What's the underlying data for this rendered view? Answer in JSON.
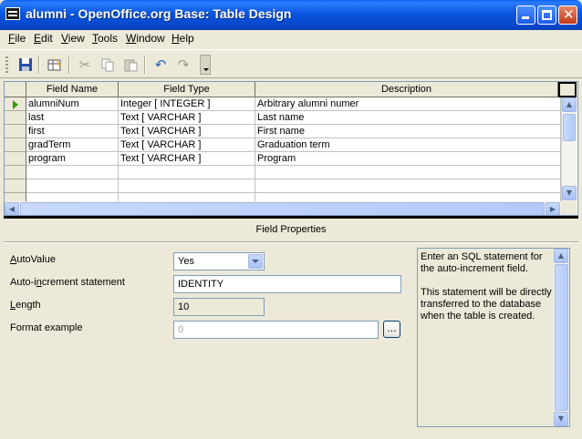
{
  "window": {
    "title": "alumni - OpenOffice.org Base: Table Design"
  },
  "menu": [
    {
      "pre": "",
      "u": "F",
      "post": "ile"
    },
    {
      "pre": "",
      "u": "E",
      "post": "dit"
    },
    {
      "pre": "",
      "u": "V",
      "post": "iew"
    },
    {
      "pre": "",
      "u": "T",
      "post": "ools"
    },
    {
      "pre": "",
      "u": "W",
      "post": "indow"
    },
    {
      "pre": "",
      "u": "H",
      "post": "elp"
    }
  ],
  "toolbar": {
    "icons": [
      "save-icon",
      "table-design-icon",
      "cut-icon",
      "copy-icon",
      "paste-icon",
      "undo-icon",
      "redo-icon",
      "more-icon"
    ]
  },
  "table": {
    "headers": {
      "field_name": "Field Name",
      "field_type": "Field Type",
      "description": "Description"
    },
    "rows": [
      {
        "name": "alumniNum",
        "type": "Integer [ INTEGER ]",
        "desc": "Arbitrary alumni numer"
      },
      {
        "name": "last",
        "type": "Text [ VARCHAR ]",
        "desc": "Last name"
      },
      {
        "name": "first",
        "type": "Text [ VARCHAR ]",
        "desc": "First name"
      },
      {
        "name": "gradTerm",
        "type": "Text [ VARCHAR ]",
        "desc": "Graduation term"
      },
      {
        "name": "program",
        "type": "Text [ VARCHAR ]",
        "desc": "Program"
      },
      {
        "name": "",
        "type": "",
        "desc": ""
      },
      {
        "name": "",
        "type": "",
        "desc": ""
      },
      {
        "name": "",
        "type": "",
        "desc": ""
      }
    ]
  },
  "field_properties": {
    "title": "Field Properties",
    "autovalue": {
      "label_u": "A",
      "label_rest": "utoValue",
      "value": "Yes"
    },
    "autoincrement": {
      "label_pre": "Auto-i",
      "label_u": "n",
      "label_rest": "crement statement",
      "value": "IDENTITY"
    },
    "length": {
      "label_u": "L",
      "label_rest": "ength",
      "value": "10"
    },
    "format": {
      "label": "Format example",
      "value": "0",
      "button": "..."
    },
    "help": "Enter an SQL statement for the auto-increment field.\n\nThis statement will be directly transferred to the database when the table is created."
  }
}
